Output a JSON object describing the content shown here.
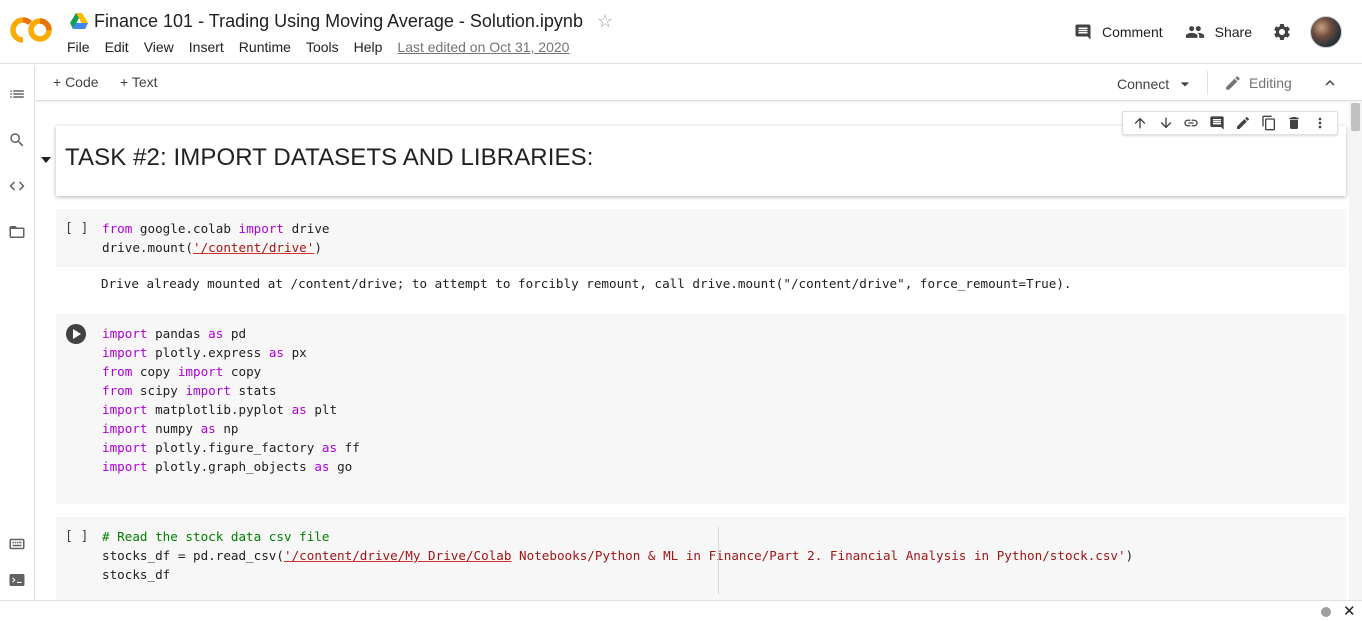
{
  "header": {
    "logo_text": "CO",
    "title": "Finance 101 - Trading Using Moving Average - Solution.ipynb",
    "menu": [
      "File",
      "Edit",
      "View",
      "Insert",
      "Runtime",
      "Tools",
      "Help"
    ],
    "last_edited": "Last edited on Oct 31, 2020",
    "comment_label": "Comment",
    "share_label": "Share"
  },
  "toolbar": {
    "add_code": "+ Code",
    "add_text": "+ Text",
    "connect": "Connect",
    "editing": "Editing"
  },
  "text_cell": {
    "heading": "TASK #2: IMPORT DATASETS AND LIBRARIES:"
  },
  "cells": {
    "cell1": {
      "bracket": "[ ]",
      "output": "Drive already mounted at /content/drive; to attempt to forcibly remount, call drive.mount(\"/content/drive\", force_remount=True)."
    },
    "cell3": {
      "bracket": "[ ]"
    }
  },
  "code_lines": {
    "c1l1": [
      "from",
      " google.colab ",
      "import",
      " drive"
    ],
    "c1l2": [
      "drive.mount(",
      "'/content/drive'",
      ")"
    ],
    "c2": [
      [
        "import",
        " pandas ",
        "as",
        " pd"
      ],
      [
        "import",
        " plotly.express ",
        "as",
        " px"
      ],
      [
        "from",
        " copy ",
        "import",
        " copy"
      ],
      [
        "from",
        " scipy ",
        "import",
        " stats"
      ],
      [
        "import",
        " matplotlib.pyplot ",
        "as",
        " plt"
      ],
      [
        "import",
        " numpy ",
        "as",
        " np"
      ],
      [
        "import",
        " plotly.figure_factory ",
        "as",
        " ff"
      ],
      [
        "import",
        " plotly.graph_objects ",
        "as",
        " go"
      ]
    ],
    "c3l1": "# Read the stock data csv file",
    "c3l2a": "stocks_df = pd.read_csv(",
    "c3l2b": "'/content/drive/My Drive/Colab",
    "c3l2c": " Notebooks/Python & ML in Finance/Part 2. Financial Analysis in Python/stock.csv'",
    "c3l2d": ")",
    "c3l3": "stocks_df"
  },
  "colors": {
    "keyword": "#af00db",
    "string": "#a31515",
    "comment": "#008000",
    "logo": "#f9ab00"
  },
  "icons": [
    "colab-logo",
    "drive-icon",
    "star-icon",
    "comment-icon",
    "share-icon",
    "gear-icon",
    "avatar",
    "toc-icon",
    "search-icon",
    "code-snippets-icon",
    "files-icon",
    "command-palette-icon",
    "terminal-icon",
    "arrow-up-icon",
    "arrow-down-icon",
    "link-icon",
    "comment-icon",
    "pencil-icon",
    "mirror-cell-icon",
    "trash-icon",
    "more-vert-icon",
    "close-icon"
  ]
}
